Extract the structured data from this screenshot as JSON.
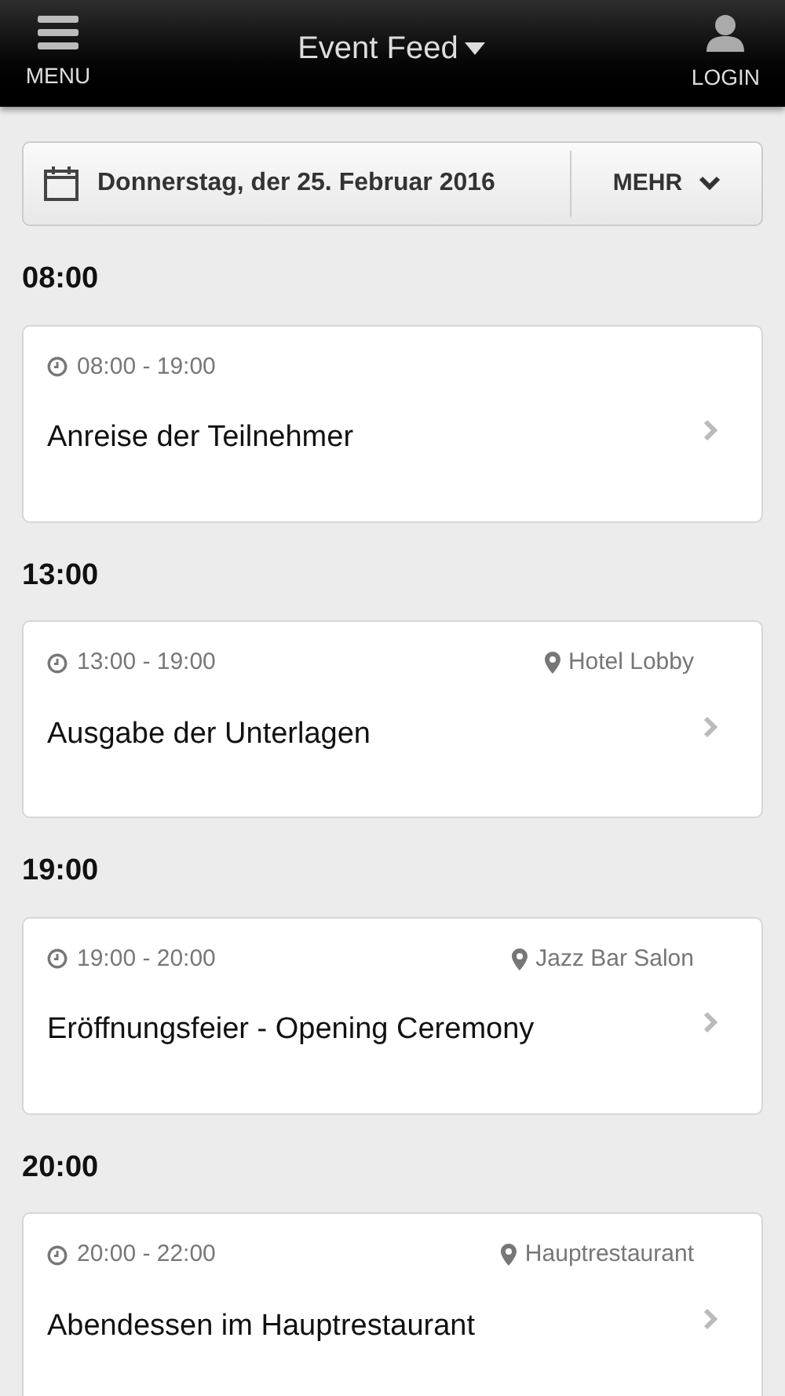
{
  "header": {
    "menu_label": "MENU",
    "title": "Event Feed",
    "login_label": "LOGIN"
  },
  "date_bar": {
    "date": "Donnerstag, der 25. Februar 2016",
    "more_label": "MEHR"
  },
  "sections": [
    {
      "time": "08:00",
      "events": [
        {
          "time_range": "08:00 - 19:00",
          "title": "Anreise der Teilnehmer"
        }
      ]
    },
    {
      "time": "13:00",
      "events": [
        {
          "time_range": "13:00 - 19:00",
          "location": "Hotel Lobby",
          "title": "Ausgabe der Unterlagen"
        }
      ]
    },
    {
      "time": "19:00",
      "events": [
        {
          "time_range": "19:00 - 20:00",
          "location": "Jazz Bar Salon",
          "title": "Eröffnungsfeier - Opening Ceremony"
        }
      ]
    },
    {
      "time": "20:00",
      "events": [
        {
          "time_range": "20:00 - 22:00",
          "location": "Hauptrestaurant",
          "title": "Abendessen im Hauptrestaurant"
        }
      ]
    }
  ]
}
